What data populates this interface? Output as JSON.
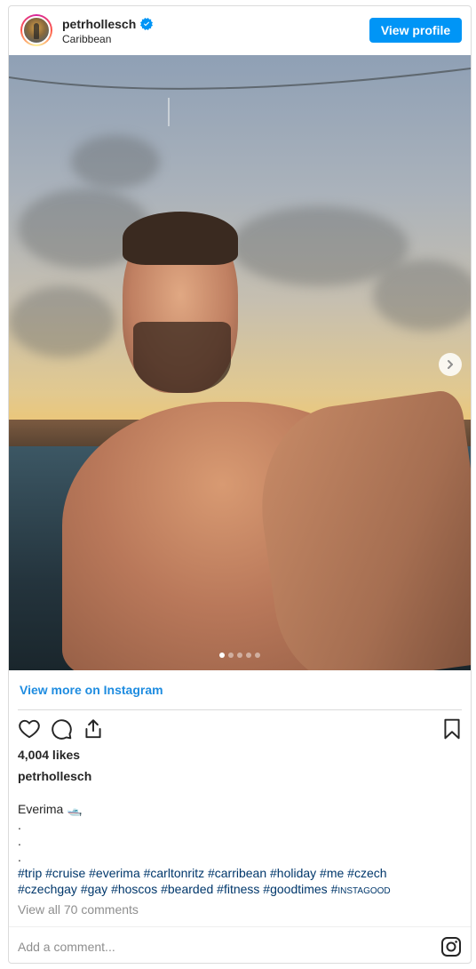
{
  "header": {
    "username": "petrhollesch",
    "location": "Caribbean",
    "view_profile_label": "View profile",
    "verified": true
  },
  "photo": {
    "carousel": {
      "count": 5,
      "active": 1
    }
  },
  "post": {
    "view_more_label": "View more on Instagram",
    "likes": "4,004 likes",
    "caption_username": "petrhollesch",
    "caption_title": "Everima 🛥️",
    "caption_dot1": ".",
    "caption_dot2": ".",
    "caption_dot3": ".",
    "hashtags_line1": "#trip #cruise #everima #carltonritz #carribean #holiday #me #czech",
    "hashtags_line2": "#czechgay #gay #hoscos #bearded #fitness #goodtimes #",
    "hashtags_line2_smallcaps": "instagood",
    "view_all_comments": "View all 70 comments",
    "add_comment_placeholder": "Add a comment..."
  },
  "colors": {
    "accent": "#0095f6",
    "link": "#00376b",
    "muted": "#8e8e8e",
    "border": "#dbdbdb"
  },
  "icons": {
    "like": "heart-icon",
    "comment": "comment-icon",
    "share": "share-icon",
    "save": "bookmark-icon",
    "brand": "instagram-icon",
    "next": "chevron-right-icon",
    "verified": "verified-badge-icon"
  }
}
